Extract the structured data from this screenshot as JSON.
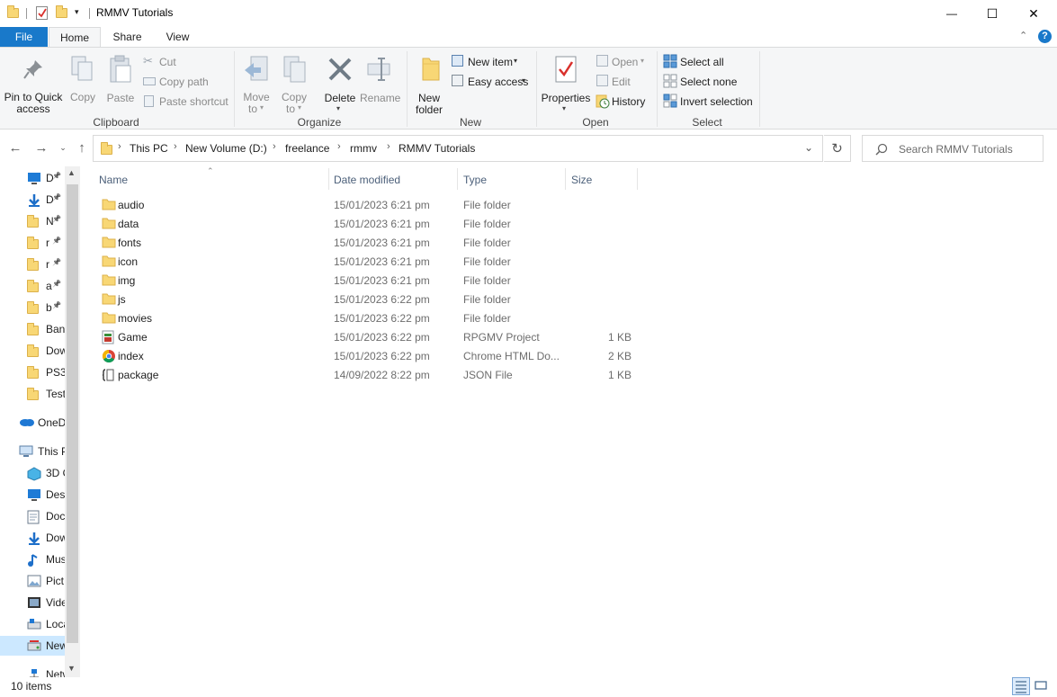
{
  "window": {
    "title": "RMMV Tutorials",
    "minimize_glyph": "—",
    "maximize_glyph": "☐",
    "close_glyph": "✕"
  },
  "ribbon_tabs": {
    "file": "File",
    "home": "Home",
    "share": "Share",
    "view": "View"
  },
  "ribbon": {
    "clipboard": {
      "group_label": "Clipboard",
      "pin_line1": "Pin to Quick",
      "pin_line2": "access",
      "copy": "Copy",
      "paste": "Paste",
      "cut": "Cut",
      "copy_path": "Copy path",
      "paste_shortcut": "Paste shortcut"
    },
    "organize": {
      "group_label": "Organize",
      "move_line1": "Move",
      "move_line2": "to",
      "copy_line1": "Copy",
      "copy_line2": "to",
      "delete": "Delete",
      "rename": "Rename"
    },
    "new": {
      "group_label": "New",
      "new_folder_line1": "New",
      "new_folder_line2": "folder",
      "new_item": "New item",
      "easy_access": "Easy access"
    },
    "open": {
      "group_label": "Open",
      "properties": "Properties",
      "open": "Open",
      "edit": "Edit",
      "history": "History"
    },
    "select": {
      "group_label": "Select",
      "select_all": "Select all",
      "select_none": "Select none",
      "invert_selection": "Invert selection"
    }
  },
  "address": {
    "crumbs": [
      "This PC",
      "New Volume (D:)",
      "freelance",
      "rmmv",
      "RMMV Tutorials"
    ],
    "search_placeholder": "Search RMMV Tutorials"
  },
  "nav_pane": {
    "items": [
      {
        "label": "D",
        "icon": "desktop-icon",
        "pinned": true
      },
      {
        "label": "D",
        "icon": "download-icon",
        "pinned": true
      },
      {
        "label": "N",
        "icon": "folder-icon",
        "pinned": true
      },
      {
        "label": "r",
        "icon": "folder-icon",
        "pinned": true
      },
      {
        "label": "r",
        "icon": "folder-icon",
        "pinned": true
      },
      {
        "label": "a",
        "icon": "folder-icon",
        "pinned": true
      },
      {
        "label": "b",
        "icon": "folder-icon",
        "pinned": true
      },
      {
        "label": "Ban",
        "icon": "folder-icon",
        "pinned": false
      },
      {
        "label": "Dow",
        "icon": "folder-icon",
        "pinned": false
      },
      {
        "label": "PS3",
        "icon": "folder-icon",
        "pinned": false
      },
      {
        "label": "Test",
        "icon": "folder-icon",
        "pinned": false
      },
      {
        "label": "OneD",
        "icon": "onedrive-icon",
        "pinned": false
      },
      {
        "label": "This P",
        "icon": "this-pc-icon",
        "pinned": false
      },
      {
        "label": "3D O",
        "icon": "3d-objects-icon",
        "pinned": false
      },
      {
        "label": "Desk",
        "icon": "desktop-icon",
        "pinned": false
      },
      {
        "label": "Doc",
        "icon": "documents-icon",
        "pinned": false
      },
      {
        "label": "Dow",
        "icon": "download-icon",
        "pinned": false
      },
      {
        "label": "Mus",
        "icon": "music-icon",
        "pinned": false
      },
      {
        "label": "Pict",
        "icon": "pictures-icon",
        "pinned": false
      },
      {
        "label": "Vide",
        "icon": "videos-icon",
        "pinned": false
      },
      {
        "label": "Loca",
        "icon": "local-disk-icon",
        "pinned": false
      },
      {
        "label": "New",
        "icon": "drive-icon",
        "pinned": false,
        "selected": true
      },
      {
        "label": "Netw",
        "icon": "network-icon",
        "pinned": false
      }
    ]
  },
  "file_list": {
    "columns": {
      "name": "Name",
      "date": "Date modified",
      "type": "Type",
      "size": "Size"
    },
    "rows": [
      {
        "name": "audio",
        "date": "15/01/2023 6:21 pm",
        "type": "File folder",
        "size": "",
        "icon": "folder-icon"
      },
      {
        "name": "data",
        "date": "15/01/2023 6:21 pm",
        "type": "File folder",
        "size": "",
        "icon": "folder-icon"
      },
      {
        "name": "fonts",
        "date": "15/01/2023 6:21 pm",
        "type": "File folder",
        "size": "",
        "icon": "folder-icon"
      },
      {
        "name": "icon",
        "date": "15/01/2023 6:21 pm",
        "type": "File folder",
        "size": "",
        "icon": "folder-icon"
      },
      {
        "name": "img",
        "date": "15/01/2023 6:21 pm",
        "type": "File folder",
        "size": "",
        "icon": "folder-icon"
      },
      {
        "name": "js",
        "date": "15/01/2023 6:22 pm",
        "type": "File folder",
        "size": "",
        "icon": "folder-icon"
      },
      {
        "name": "movies",
        "date": "15/01/2023 6:22 pm",
        "type": "File folder",
        "size": "",
        "icon": "folder-icon"
      },
      {
        "name": "Game",
        "date": "15/01/2023 6:22 pm",
        "type": "RPGMV Project",
        "size": "1 KB",
        "icon": "rpgmv-project-icon"
      },
      {
        "name": "index",
        "date": "15/01/2023 6:22 pm",
        "type": "Chrome HTML Do...",
        "size": "2 KB",
        "icon": "chrome-icon"
      },
      {
        "name": "package",
        "date": "14/09/2022 8:22 pm",
        "type": "JSON File",
        "size": "1 KB",
        "icon": "json-file-icon"
      }
    ]
  },
  "status": {
    "item_count": "10 items"
  },
  "colors": {
    "accent": "#1979ca",
    "selection": "#cce8ff",
    "folder": "#f8d775"
  }
}
